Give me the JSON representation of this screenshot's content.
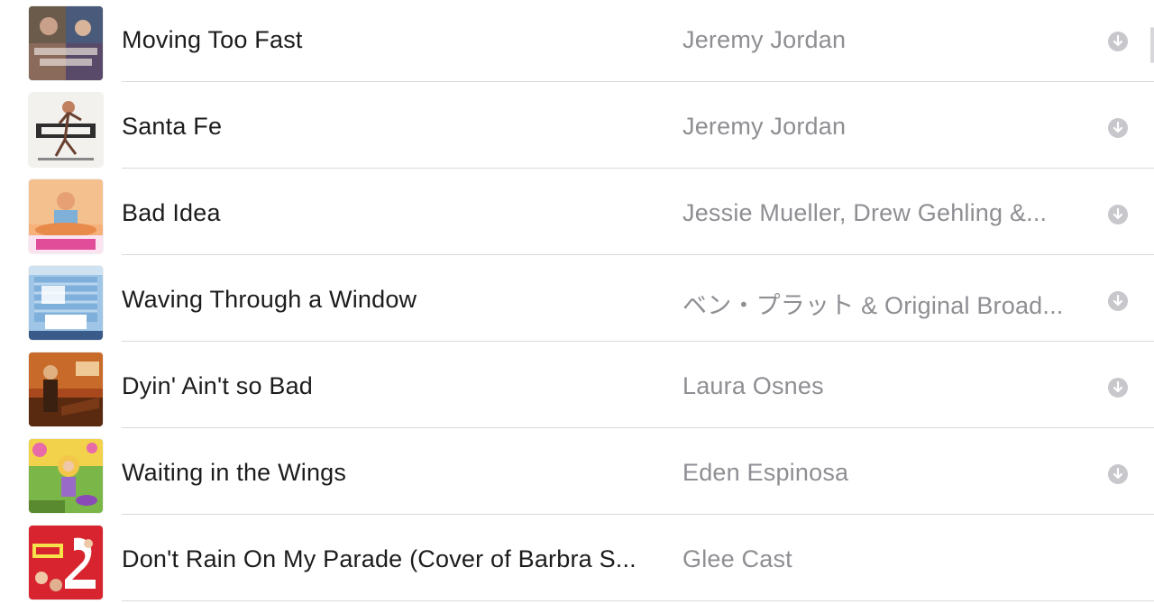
{
  "songs": [
    {
      "title": "Moving Too Fast",
      "artist": "Jeremy Jordan",
      "artwork": "the-last-five-years-artwork",
      "downloadable": true
    },
    {
      "title": "Santa Fe",
      "artist": "Jeremy Jordan",
      "artwork": "newsies-artwork",
      "downloadable": true
    },
    {
      "title": "Bad Idea",
      "artist": "Jessie Mueller, Drew Gehling &...",
      "artwork": "waitress-artwork",
      "downloadable": true
    },
    {
      "title": "Waving Through a Window",
      "artist": "ベン・プラット & Original Broad...",
      "artwork": "dear-evan-hansen-artwork",
      "downloadable": true
    },
    {
      "title": "Dyin' Ain't so Bad",
      "artist": "Laura Osnes",
      "artwork": "bonnie-and-clyde-artwork",
      "downloadable": true
    },
    {
      "title": "Waiting in the Wings",
      "artist": "Eden Espinosa",
      "artwork": "rapunzel-artwork",
      "downloadable": true
    },
    {
      "title": "Don't Rain On My Parade (Cover of Barbra S...",
      "artist": "Glee Cast",
      "artwork": "glee-artwork",
      "downloadable": false
    }
  ],
  "icons": {
    "download": "download-arrow-icon"
  },
  "colors": {
    "title_text": "#1c1c1e",
    "artist_text": "#8e8e93",
    "download_icon": "#c7c7cc",
    "separator": "#d9d9de"
  }
}
